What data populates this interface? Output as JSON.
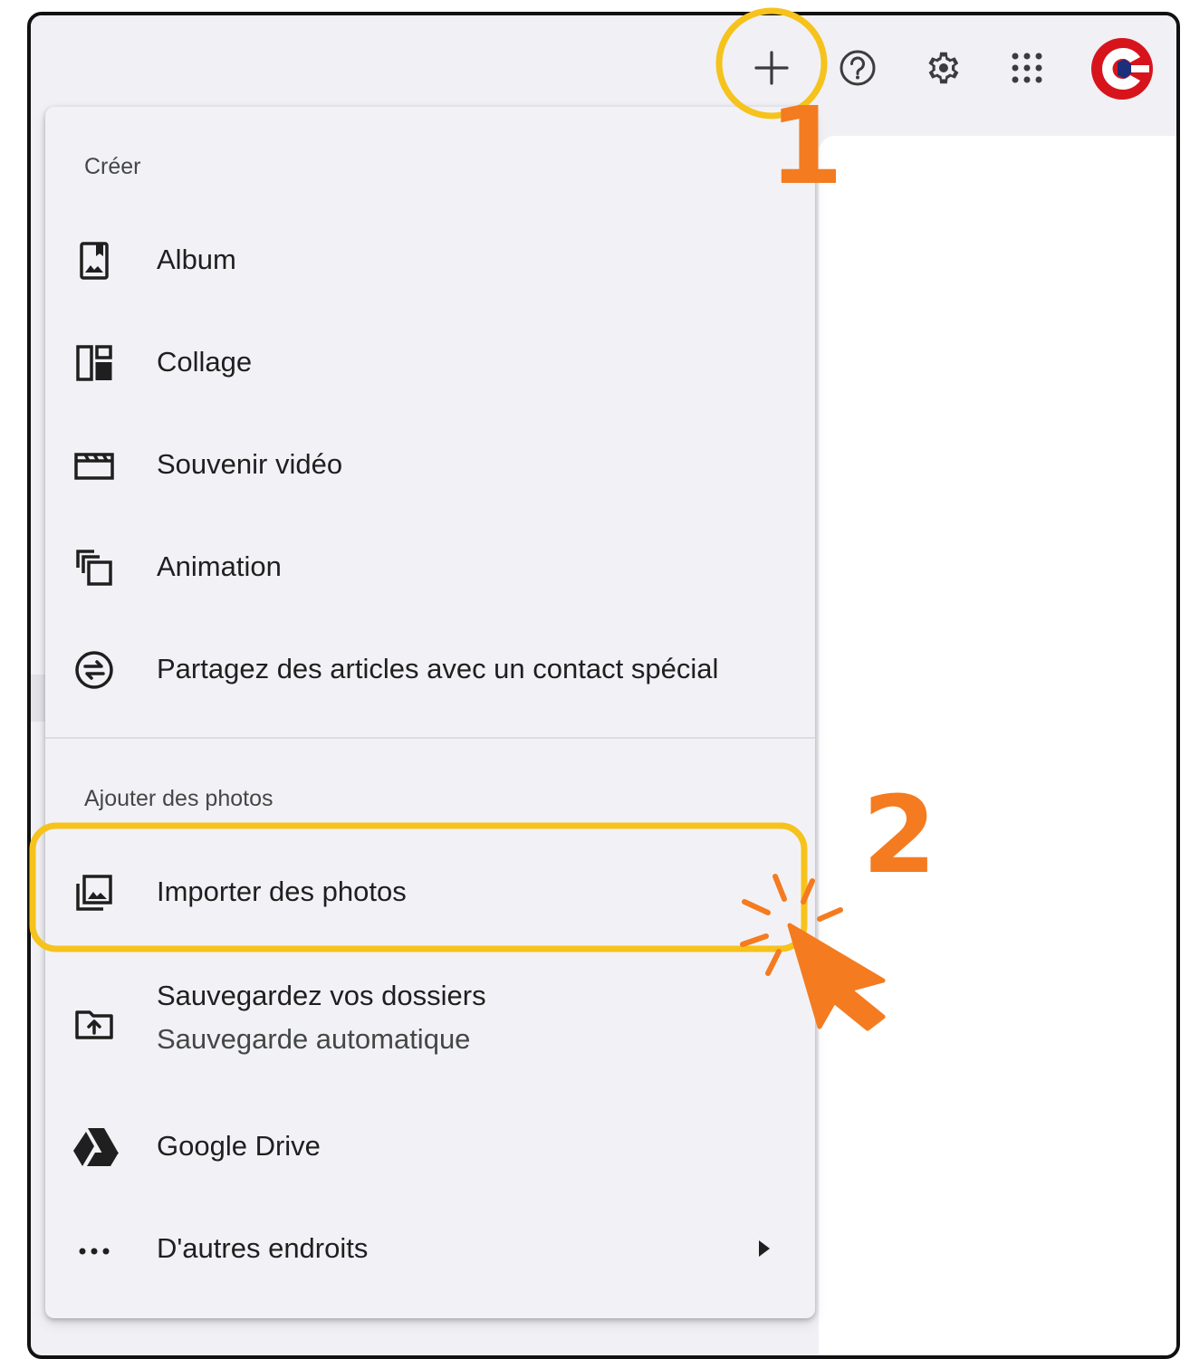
{
  "toolbar": {
    "icons": [
      "plus-icon",
      "help-icon",
      "settings-icon",
      "apps-grid-icon",
      "account-avatar"
    ]
  },
  "menu": {
    "sections": [
      {
        "label": "Créer",
        "items": [
          {
            "label": "Album",
            "icon": "album-icon"
          },
          {
            "label": "Collage",
            "icon": "collage-icon"
          },
          {
            "label": "Souvenir vidéo",
            "icon": "movie-icon"
          },
          {
            "label": "Animation",
            "icon": "animation-icon"
          },
          {
            "label": "Partagez des articles avec un contact spécial",
            "icon": "partner-sharing-icon"
          }
        ]
      },
      {
        "label": "Ajouter des photos",
        "items": [
          {
            "label": "Importer des photos",
            "icon": "import-photos-icon"
          },
          {
            "label": "Sauvegardez vos dossiers",
            "sublabel": "Sauvegarde automatique",
            "icon": "backup-folder-icon"
          },
          {
            "label": "Google Drive",
            "icon": "google-drive-icon"
          },
          {
            "label": "D'autres endroits",
            "icon": "more-horiz-icon"
          }
        ]
      }
    ]
  },
  "annotations": {
    "step1": "1",
    "step2": "2",
    "highlight_color": "#f6c21c",
    "step_color": "#f47b20"
  },
  "colors": {
    "avatar_red": "#d7141c",
    "avatar_blue": "#1c2f7a",
    "text_primary": "#1f1f1f",
    "text_secondary": "#444746"
  }
}
